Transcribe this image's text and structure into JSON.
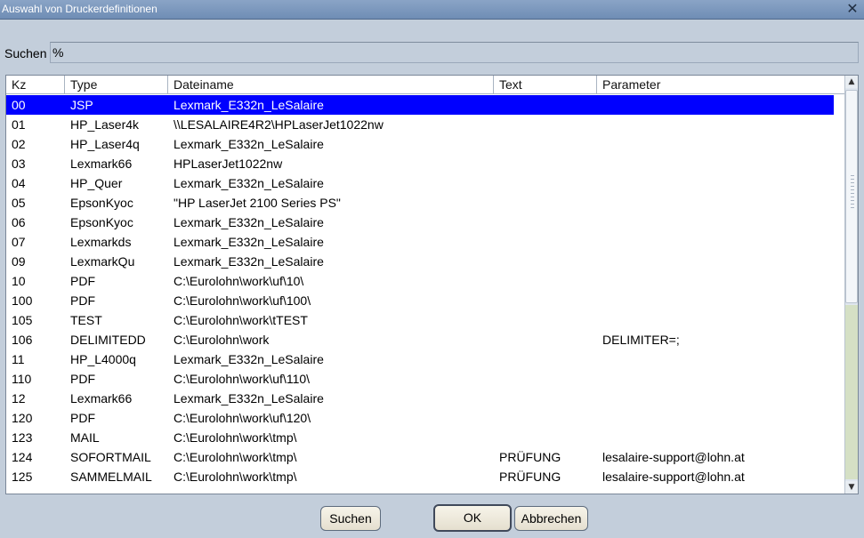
{
  "window": {
    "title": "Auswahl von Druckerdefinitionen",
    "close_glyph": "✕"
  },
  "search": {
    "label": "Suchen",
    "value": "%"
  },
  "table": {
    "columns": [
      "Kz",
      "Type",
      "Dateiname",
      "Text",
      "Parameter"
    ],
    "rows": [
      {
        "kz": "00",
        "type": "JSP",
        "dateiname": "Lexmark_E332n_LeSalaire",
        "text": "",
        "parameter": ""
      },
      {
        "kz": "01",
        "type": "HP_Laser4k",
        "dateiname": "\\\\LESALAIRE4R2\\HPLaserJet1022nw",
        "text": "",
        "parameter": ""
      },
      {
        "kz": "02",
        "type": "HP_Laser4q",
        "dateiname": "Lexmark_E332n_LeSalaire",
        "text": "",
        "parameter": ""
      },
      {
        "kz": "03",
        "type": "Lexmark66",
        "dateiname": "HPLaserJet1022nw",
        "text": "",
        "parameter": ""
      },
      {
        "kz": "04",
        "type": "HP_Quer",
        "dateiname": "Lexmark_E332n_LeSalaire",
        "text": "",
        "parameter": ""
      },
      {
        "kz": "05",
        "type": "EpsonKyoc",
        "dateiname": "\"HP LaserJet 2100 Series PS\"",
        "text": "",
        "parameter": ""
      },
      {
        "kz": "06",
        "type": "EpsonKyoc",
        "dateiname": "Lexmark_E332n_LeSalaire",
        "text": "",
        "parameter": ""
      },
      {
        "kz": "07",
        "type": "Lexmarkds",
        "dateiname": "Lexmark_E332n_LeSalaire",
        "text": "",
        "parameter": ""
      },
      {
        "kz": "09",
        "type": "LexmarkQu",
        "dateiname": "Lexmark_E332n_LeSalaire",
        "text": "",
        "parameter": ""
      },
      {
        "kz": "10",
        "type": "PDF",
        "dateiname": "C:\\Eurolohn\\work\\uf\\10\\",
        "text": "",
        "parameter": ""
      },
      {
        "kz": "100",
        "type": "PDF",
        "dateiname": "C:\\Eurolohn\\work\\uf\\100\\",
        "text": "",
        "parameter": ""
      },
      {
        "kz": "105",
        "type": "TEST",
        "dateiname": "C:\\Eurolohn\\work\\tTEST",
        "text": "",
        "parameter": ""
      },
      {
        "kz": "106",
        "type": "DELIMITEDD",
        "dateiname": "C:\\Eurolohn\\work",
        "text": "",
        "parameter": "DELIMITER=;"
      },
      {
        "kz": "11",
        "type": "HP_L4000q",
        "dateiname": "Lexmark_E332n_LeSalaire",
        "text": "",
        "parameter": ""
      },
      {
        "kz": "110",
        "type": "PDF",
        "dateiname": "C:\\Eurolohn\\work\\uf\\110\\",
        "text": "",
        "parameter": ""
      },
      {
        "kz": "12",
        "type": "Lexmark66",
        "dateiname": "Lexmark_E332n_LeSalaire",
        "text": "",
        "parameter": ""
      },
      {
        "kz": "120",
        "type": "PDF",
        "dateiname": "C:\\Eurolohn\\work\\uf\\120\\",
        "text": "",
        "parameter": ""
      },
      {
        "kz": "123",
        "type": "MAIL",
        "dateiname": "C:\\Eurolohn\\work\\tmp\\",
        "text": "",
        "parameter": ""
      },
      {
        "kz": "124",
        "type": "SOFORTMAIL",
        "dateiname": "C:\\Eurolohn\\work\\tmp\\",
        "text": "PRÜFUNG",
        "parameter": "lesalaire-support@lohn.at"
      },
      {
        "kz": "125",
        "type": "SAMMELMAIL",
        "dateiname": "C:\\Eurolohn\\work\\tmp\\",
        "text": "PRÜFUNG",
        "parameter": "lesalaire-support@lohn.at"
      }
    ],
    "selected_index": 0
  },
  "buttons": {
    "search": "Suchen",
    "ok": "OK",
    "cancel": "Abbrechen"
  },
  "colors": {
    "selection": "#0000ff",
    "background": "#c3cedb"
  }
}
